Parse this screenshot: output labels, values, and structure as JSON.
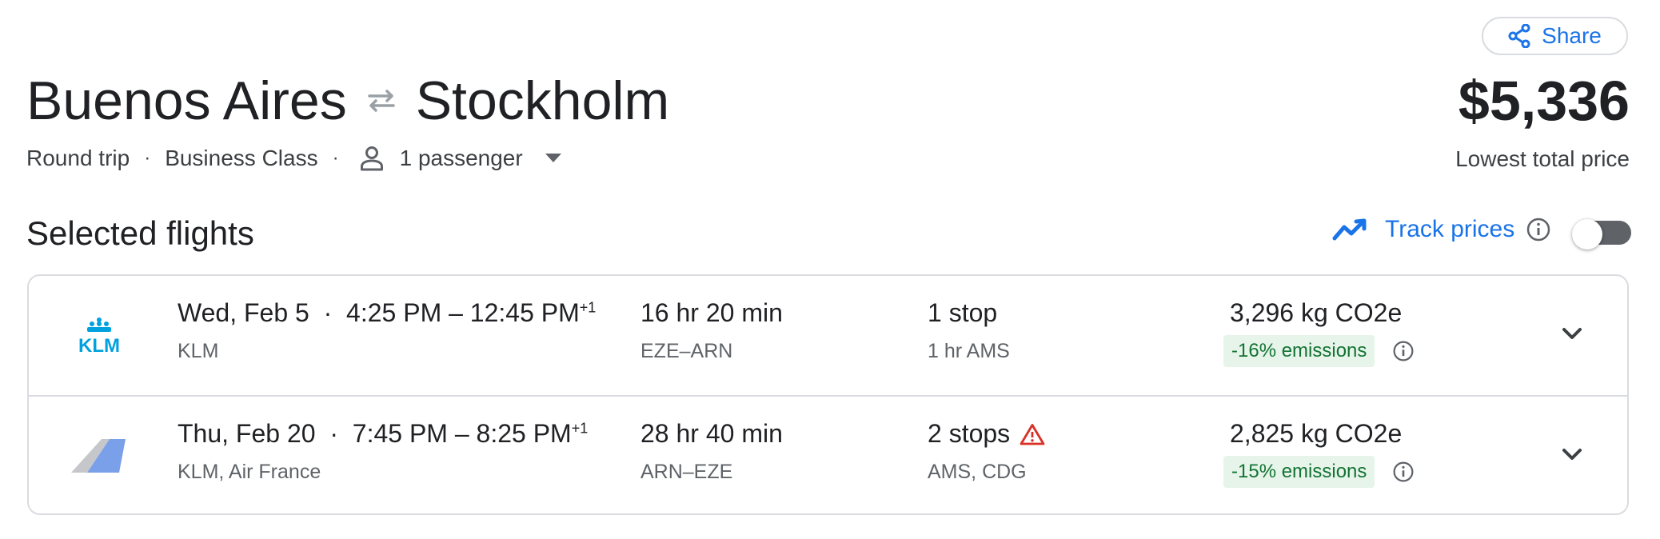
{
  "header": {
    "share_label": "Share",
    "origin": "Buenos Aires",
    "destination": "Stockholm",
    "trip_type": "Round trip",
    "cabin_class": "Business Class",
    "passengers": "1 passenger",
    "price": "$5,336",
    "price_label": "Lowest total price"
  },
  "section": {
    "title": "Selected flights",
    "track_label": "Track prices",
    "track_enabled": false
  },
  "flights": [
    {
      "date": "Wed, Feb 5",
      "times": "4:25 PM – 12:45 PM",
      "day_offset": "+1",
      "airline": "KLM",
      "logo": "klm-logo",
      "duration": "16 hr 20 min",
      "route": "EZE–ARN",
      "stops": "1 stop",
      "stops_detail": "1 hr AMS",
      "warning": false,
      "co2": "3,296 kg CO2e",
      "emissions": "-16% emissions"
    },
    {
      "date": "Thu, Feb 20",
      "times": "7:45 PM – 8:25 PM",
      "day_offset": "+1",
      "airline": "KLM, Air France",
      "logo": "multi-airline-tail-logo",
      "duration": "28 hr 40 min",
      "route": "ARN–EZE",
      "stops": "2 stops",
      "stops_detail": "AMS, CDG",
      "warning": true,
      "co2": "2,825 kg CO2e",
      "emissions": "-15% emissions"
    }
  ],
  "colors": {
    "accent": "#1a73e8",
    "text": "#202124",
    "muted": "#5f6368",
    "emissions_bg": "#e6f4ea",
    "emissions_text": "#137333",
    "warning": "#d93025",
    "klm_blue": "#00a1de"
  }
}
